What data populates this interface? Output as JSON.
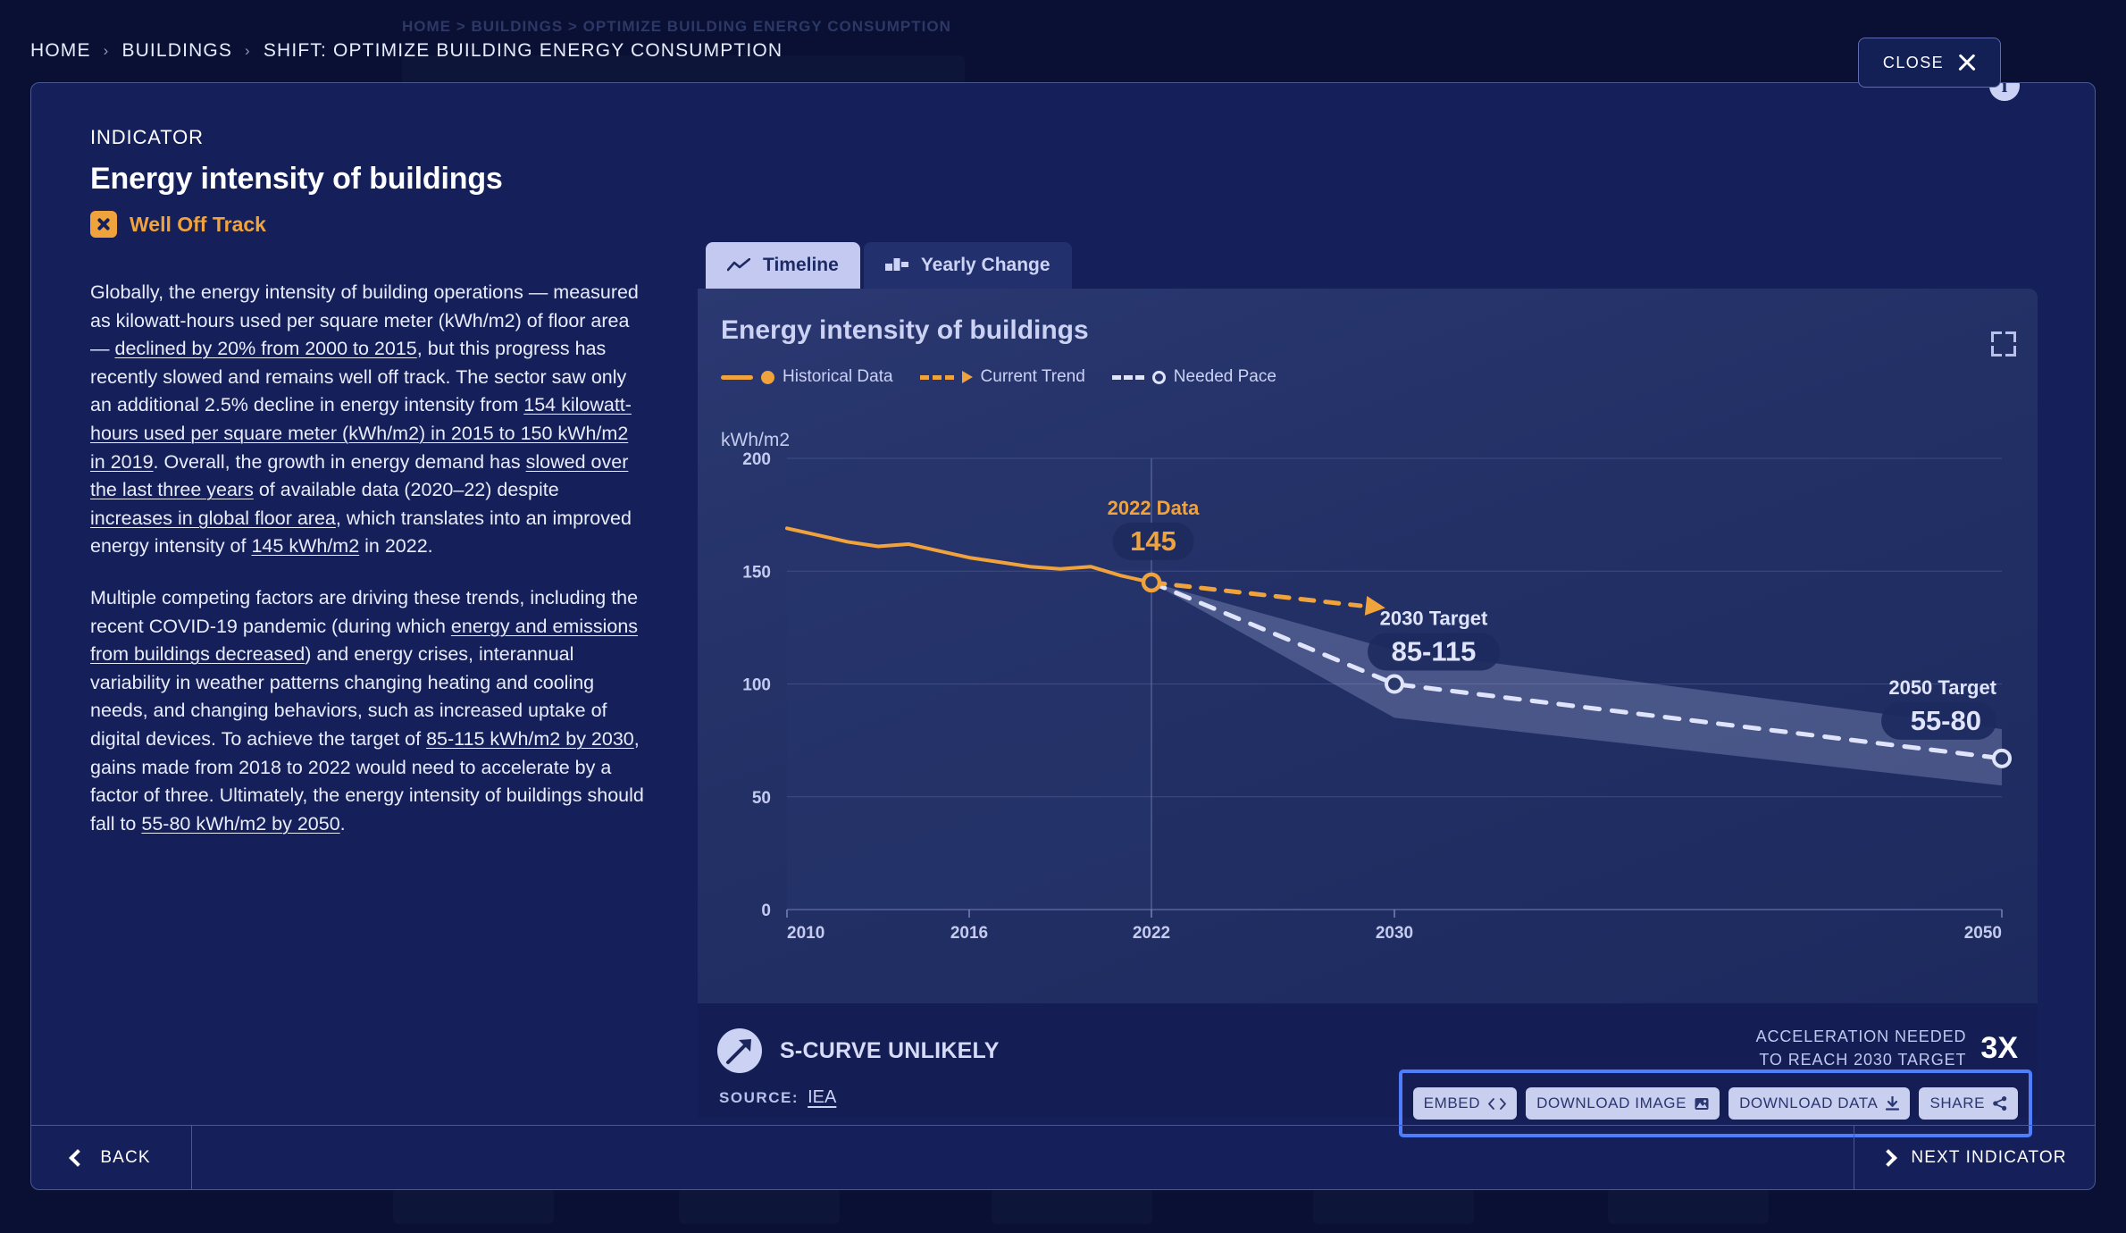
{
  "breadcrumb": {
    "items": [
      "HOME",
      "BUILDINGS",
      "SHIFT: OPTIMIZE BUILDING ENERGY CONSUMPTION"
    ],
    "separator": "›"
  },
  "backdrop": {
    "ghost_breadcrumb": "HOME  >  BUILDINGS  >  OPTIMIZE BUILDING ENERGY CONSUMPTION"
  },
  "close": {
    "label": "CLOSE",
    "icon": "close-icon"
  },
  "indicator": {
    "eyebrow": "INDICATOR",
    "title": "Energy intensity of buildings",
    "status": {
      "label": "Well Off Track",
      "color": "#f0a33c",
      "icon": "x-mark-icon"
    },
    "paragraph1_parts": [
      {
        "t": "Globally, the energy intensity of building operations — measured as kilowatt-hours used per square meter (kWh/m2) of floor area — ",
        "u": false
      },
      {
        "t": "declined by 20% from 2000 to 2015",
        "u": true
      },
      {
        "t": ", but this progress has recently slowed and remains well off track. The sector saw only an additional 2.5% decline in energy intensity from ",
        "u": false
      },
      {
        "t": "154 kilowatt-hours used per square meter (kWh/m2) in 2015 to 150 kWh/m2 in 2019",
        "u": true
      },
      {
        "t": ". Overall, the growth in energy demand has ",
        "u": false
      },
      {
        "t": "slowed over the last three years",
        "u": true
      },
      {
        "t": " of available data (2020–22) despite ",
        "u": false
      },
      {
        "t": "increases in global floor area",
        "u": true
      },
      {
        "t": ", which translates into an improved energy intensity of ",
        "u": false
      },
      {
        "t": "145 kWh/m2",
        "u": true
      },
      {
        "t": " in 2022.",
        "u": false
      }
    ],
    "paragraph2_parts": [
      {
        "t": "Multiple competing factors are driving these trends, including the recent COVID-19 pandemic (during which ",
        "u": false
      },
      {
        "t": "energy and emissions from buildings decreased",
        "u": true
      },
      {
        "t": ") and energy crises, interannual variability in weather patterns changing heating and cooling needs, and changing behaviors, such as increased uptake of digital devices. To achieve the target of ",
        "u": false
      },
      {
        "t": "85-115 kWh/m2 by 2030",
        "u": true
      },
      {
        "t": ", gains made from 2018 to 2022 would need to accelerate by a factor of three. Ultimately, the energy intensity of buildings should fall to ",
        "u": false
      },
      {
        "t": "55-80 kWh/m2 by 2050",
        "u": true
      },
      {
        "t": ".",
        "u": false
      }
    ]
  },
  "tabs": [
    {
      "label": "Timeline",
      "icon": "line-chart-icon",
      "active": true
    },
    {
      "label": "Yearly Change",
      "icon": "bar-chart-icon",
      "active": false
    }
  ],
  "chart_card": {
    "title": "Energy intensity of buildings",
    "info_icon": "info-icon",
    "expand_icon": "fullscreen-icon",
    "legend": [
      {
        "label": "Historical Data",
        "style": "solid-line-dot",
        "color": "#f0a33c"
      },
      {
        "label": "Current Trend",
        "style": "dashed-arrow",
        "color": "#f0a33c"
      },
      {
        "label": "Needed Pace",
        "style": "dashed-hollow-dot",
        "color": "#dfe4fb"
      }
    ]
  },
  "footer": {
    "scurve_label": "S-CURVE UNLIKELY",
    "scurve_icon": "arrow-up-right-icon",
    "acceleration_line1": "ACCELERATION NEEDED",
    "acceleration_line2": "TO REACH 2030 TARGET",
    "acceleration_factor": "3X",
    "source_label": "SOURCE:",
    "source_value": "IEA",
    "actions": [
      {
        "label": "EMBED",
        "icon": "code-icon"
      },
      {
        "label": "DOWNLOAD IMAGE",
        "icon": "image-icon"
      },
      {
        "label": "DOWNLOAD DATA",
        "icon": "download-icon"
      },
      {
        "label": "SHARE",
        "icon": "share-icon"
      }
    ]
  },
  "nav": {
    "back_label": "BACK",
    "back_icon": "chevron-left-icon",
    "next_label": "NEXT INDICATOR",
    "next_icon": "chevron-right-icon"
  },
  "chart_data": {
    "type": "line",
    "title": "Energy intensity of buildings",
    "xlabel": "",
    "ylabel": "kWh/m2",
    "ylim": [
      0,
      200
    ],
    "yticks": [
      0,
      50,
      100,
      150,
      200
    ],
    "xlim": [
      2010,
      2050
    ],
    "xticks": [
      2010,
      2016,
      2022,
      2030,
      2050
    ],
    "grid": true,
    "legend_position": "top-left",
    "series": [
      {
        "name": "Historical Data",
        "style": "solid",
        "color": "#f0a33c",
        "x": [
          2010,
          2011,
          2012,
          2013,
          2014,
          2015,
          2016,
          2017,
          2018,
          2019,
          2020,
          2021,
          2022
        ],
        "y": [
          169,
          166,
          163,
          161,
          162,
          159,
          156,
          154,
          152,
          151,
          152,
          148,
          145
        ]
      },
      {
        "name": "Current Trend",
        "style": "dashed-arrow",
        "color": "#f0a33c",
        "x": [
          2022,
          2030
        ],
        "y": [
          145,
          133
        ]
      },
      {
        "name": "Needed Pace",
        "style": "dashed",
        "color": "#dfe4fb",
        "x": [
          2022,
          2030,
          2050
        ],
        "y": [
          145,
          100,
          67
        ]
      },
      {
        "name": "Target Band",
        "style": "band",
        "color": "#8f9acb",
        "x": [
          2022,
          2030,
          2050
        ],
        "y_upper": [
          145,
          115,
          80
        ],
        "y_lower": [
          145,
          85,
          55
        ]
      }
    ],
    "annotations": [
      {
        "name": "2022 Data",
        "value": "145",
        "x": 2022,
        "y": 145,
        "color": "#f0a33c"
      },
      {
        "name": "2030 Target",
        "value": "85-115",
        "x": 2030,
        "y": 100,
        "color": "#dfe4fb"
      },
      {
        "name": "2050 Target",
        "value": "55-80",
        "x": 2050,
        "y": 67,
        "color": "#dfe4fb"
      }
    ]
  }
}
